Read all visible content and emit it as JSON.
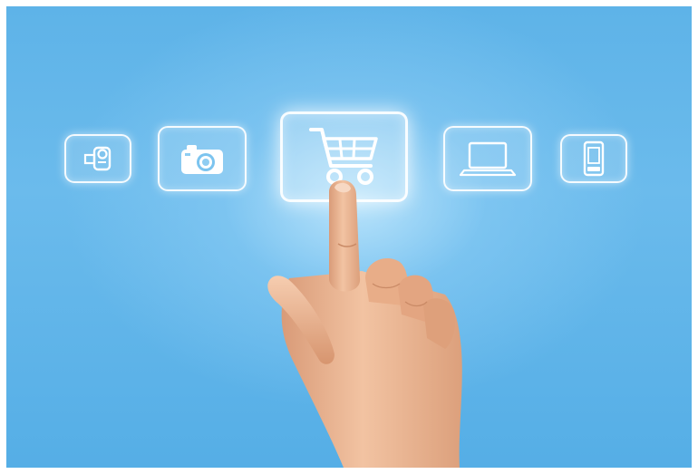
{
  "scene": {
    "background_color": "#5eb3e8",
    "glow_color": "#bfe6fc",
    "tile_border_color": "#ffffff",
    "skin_color": "#e9b28e"
  },
  "icons": [
    {
      "name": "video-camera-icon",
      "selected": false
    },
    {
      "name": "photo-camera-icon",
      "selected": false
    },
    {
      "name": "shopping-cart-icon",
      "selected": true
    },
    {
      "name": "laptop-icon",
      "selected": false
    },
    {
      "name": "smartphone-icon",
      "selected": false
    }
  ]
}
